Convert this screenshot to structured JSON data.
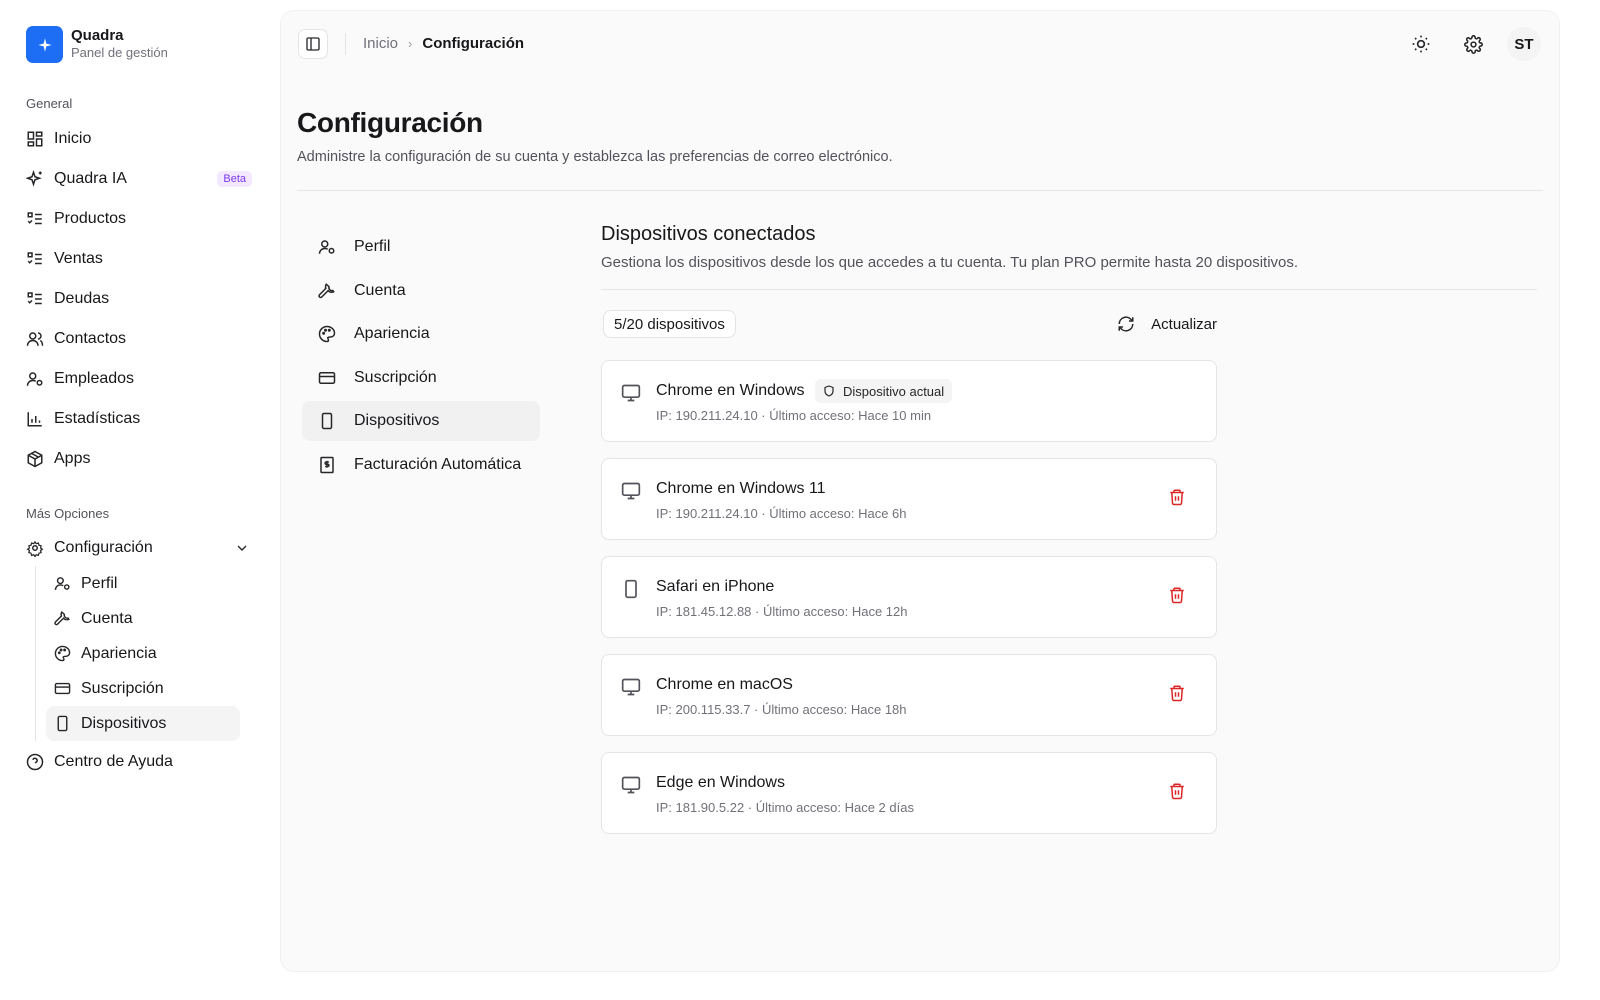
{
  "brand": {
    "name": "Quadra",
    "subtitle": "Panel de gestión",
    "logo_icon": "sparkle-icon",
    "accent": "#1d6ef5"
  },
  "sidebar": {
    "general_label": "General",
    "items": [
      {
        "label": "Inicio",
        "icon": "grid-icon"
      },
      {
        "label": "Quadra IA",
        "icon": "sparkles-icon",
        "badge": "Beta"
      },
      {
        "label": "Productos",
        "icon": "list-checks-icon"
      },
      {
        "label": "Ventas",
        "icon": "list-checks-icon"
      },
      {
        "label": "Deudas",
        "icon": "list-checks-icon"
      },
      {
        "label": "Contactos",
        "icon": "users-icon"
      },
      {
        "label": "Empleados",
        "icon": "user-cog-icon"
      },
      {
        "label": "Estadísticas",
        "icon": "bar-chart-icon"
      },
      {
        "label": "Apps",
        "icon": "package-icon"
      }
    ],
    "more_label": "Más Opciones",
    "config": {
      "label": "Configuración",
      "icon": "gear-icon",
      "expanded": true,
      "children": [
        {
          "label": "Perfil",
          "icon": "user-cog-icon"
        },
        {
          "label": "Cuenta",
          "icon": "wrench-icon"
        },
        {
          "label": "Apariencia",
          "icon": "palette-icon"
        },
        {
          "label": "Suscripción",
          "icon": "credit-card-icon"
        },
        {
          "label": "Dispositivos",
          "icon": "smartphone-icon",
          "active": true
        }
      ]
    },
    "help": {
      "label": "Centro de Ayuda",
      "icon": "help-circle-icon"
    }
  },
  "header": {
    "breadcrumb": {
      "home": "Inicio",
      "separator": "›",
      "current": "Configuración"
    },
    "avatar_initials": "ST",
    "icons": [
      "sun-icon",
      "gear-icon"
    ]
  },
  "page": {
    "title": "Configuración",
    "subtitle": "Administre la configuración de su cuenta y establezca las preferencias de correo electrónico."
  },
  "settings_nav": [
    {
      "label": "Perfil",
      "icon": "user-cog-icon"
    },
    {
      "label": "Cuenta",
      "icon": "wrench-icon"
    },
    {
      "label": "Apariencia",
      "icon": "palette-icon"
    },
    {
      "label": "Suscripción",
      "icon": "credit-card-icon"
    },
    {
      "label": "Dispositivos",
      "icon": "smartphone-icon",
      "active": true
    },
    {
      "label": "Facturación Automática",
      "icon": "receipt-icon"
    }
  ],
  "devices_section": {
    "title": "Dispositivos conectados",
    "subtitle": "Gestiona los dispositivos desde los que accedes a tu cuenta. Tu plan PRO permite hasta 20 dispositivos.",
    "count_label": "5/20 dispositivos",
    "refresh_label": "Actualizar",
    "current_badge": "Dispositivo actual",
    "delete_color": "#dc2626",
    "devices": [
      {
        "name": "Chrome en Windows",
        "meta": "IP: 190.211.24.10 · Último acceso: Hace 10 min",
        "icon": "monitor-icon",
        "current": true
      },
      {
        "name": "Chrome en Windows 11",
        "meta": "IP: 190.211.24.10 · Último acceso: Hace 6h",
        "icon": "monitor-icon",
        "current": false
      },
      {
        "name": "Safari en iPhone",
        "meta": "IP: 181.45.12.88 · Último acceso: Hace 12h",
        "icon": "smartphone-icon",
        "current": false
      },
      {
        "name": "Chrome en macOS",
        "meta": "IP: 200.115.33.7 · Último acceso: Hace 18h",
        "icon": "monitor-icon",
        "current": false
      },
      {
        "name": "Edge en Windows",
        "meta": "IP: 181.90.5.22 · Último acceso: Hace 2 días",
        "icon": "monitor-icon",
        "current": false
      }
    ]
  }
}
